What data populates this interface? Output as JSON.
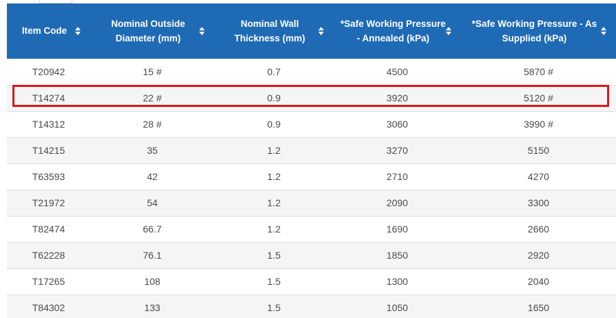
{
  "table": {
    "columns": [
      {
        "label": "Item Code",
        "sort_icon": "sort-icon"
      },
      {
        "label": "Nominal Outside Diameter (mm)",
        "sort_icon": "sort-icon"
      },
      {
        "label": "Nominal Wall Thickness (mm)",
        "sort_icon": "sort-icon"
      },
      {
        "label": "*Safe Working Pressure - Annealed (kPa)",
        "sort_icon": "sort-icon"
      },
      {
        "label": "*Safe Working Pressure - As Supplied (kPa)",
        "sort_icon": "sort-icon"
      }
    ],
    "rows": [
      [
        "T20942",
        "15 #",
        "0.7",
        "4500",
        "5870 #"
      ],
      [
        "T14274",
        "22 #",
        "0.9",
        "3920",
        "5120 #"
      ],
      [
        "T14312",
        "28 #",
        "0.9",
        "3060",
        "3990 #"
      ],
      [
        "T14215",
        "35",
        "1.2",
        "3270",
        "5150"
      ],
      [
        "T63593",
        "42",
        "1.2",
        "2710",
        "4270"
      ],
      [
        "T21972",
        "54",
        "1.2",
        "2090",
        "3300"
      ],
      [
        "T82474",
        "66.7",
        "1.2",
        "1690",
        "2660"
      ],
      [
        "T62228",
        "76.1",
        "1.5",
        "1850",
        "2920"
      ],
      [
        "T17265",
        "108",
        "1.5",
        "1300",
        "2040"
      ],
      [
        "T84302",
        "133",
        "1.5",
        "1050",
        "1650"
      ]
    ],
    "highlighted_row": 1
  },
  "colors": {
    "header_bg": "#1f6ab5",
    "header_text": "#ffffff",
    "highlight_border": "#e0151b",
    "row_alt_bg": "#f5f5f5"
  }
}
